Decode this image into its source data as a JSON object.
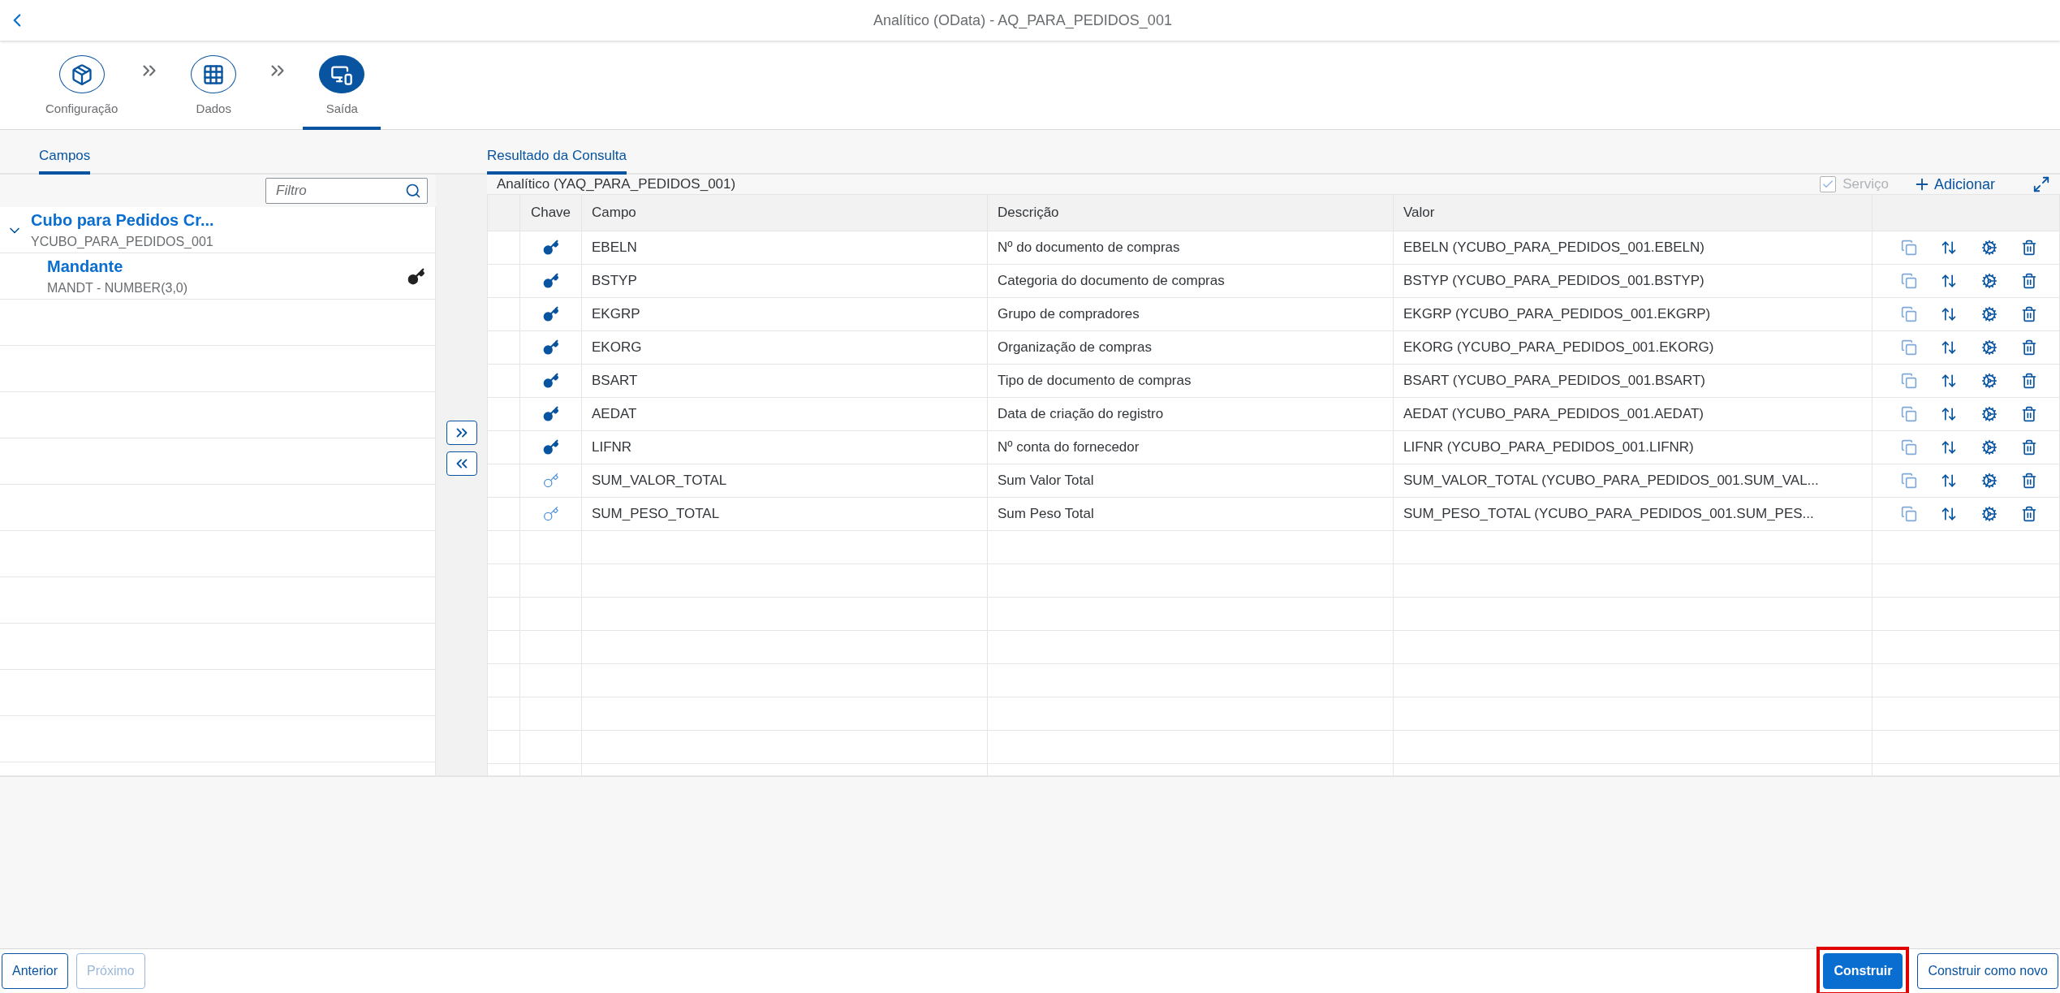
{
  "header": {
    "title": "Analítico (OData) - AQ_PARA_PEDIDOS_001"
  },
  "steps": [
    {
      "label": "Configuração",
      "kind": "config",
      "selected": false
    },
    {
      "label": "Dados",
      "kind": "data",
      "selected": false
    },
    {
      "label": "Saída",
      "kind": "output",
      "selected": true
    }
  ],
  "left_pane": {
    "tab": {
      "label": "Campos",
      "selected": true
    },
    "filter": {
      "placeholder": "Filtro"
    },
    "tree": [
      {
        "title": "Cubo para Pedidos Cr...",
        "subtitle": "YCUBO_PARA_PEDIDOS_001",
        "expanded": true,
        "children": [
          {
            "title": "Mandante",
            "subtitle": "MANDT - NUMBER(3,0)",
            "key": true
          }
        ]
      }
    ]
  },
  "right_pane": {
    "tab": {
      "label": "Resultado da Consulta",
      "selected": true
    },
    "title": "Analítico (YAQ_PARA_PEDIDOS_001)",
    "service": {
      "label": "Serviço",
      "checked": true,
      "disabled": true
    },
    "add_button": "Adicionar",
    "table": {
      "columns": [
        "Chave",
        "Campo",
        "Descrição",
        "Valor"
      ],
      "rows": [
        {
          "key": true,
          "field": "EBELN",
          "description": "Nº do documento de compras",
          "value": "EBELN (YCUBO_PARA_PEDIDOS_001.EBELN)"
        },
        {
          "key": true,
          "field": "BSTYP",
          "description": "Categoria do documento de compras",
          "value": "BSTYP (YCUBO_PARA_PEDIDOS_001.BSTYP)"
        },
        {
          "key": true,
          "field": "EKGRP",
          "description": "Grupo de compradores",
          "value": "EKGRP (YCUBO_PARA_PEDIDOS_001.EKGRP)"
        },
        {
          "key": true,
          "field": "EKORG",
          "description": "Organização de compras",
          "value": "EKORG (YCUBO_PARA_PEDIDOS_001.EKORG)"
        },
        {
          "key": true,
          "field": "BSART",
          "description": "Tipo de documento de compras",
          "value": "BSART (YCUBO_PARA_PEDIDOS_001.BSART)"
        },
        {
          "key": true,
          "field": "AEDAT",
          "description": "Data de criação do registro",
          "value": "AEDAT (YCUBO_PARA_PEDIDOS_001.AEDAT)"
        },
        {
          "key": true,
          "field": "LIFNR",
          "description": "Nº conta do fornecedor",
          "value": "LIFNR (YCUBO_PARA_PEDIDOS_001.LIFNR)"
        },
        {
          "key": false,
          "field": "SUM_VALOR_TOTAL",
          "description": "Sum Valor Total",
          "value": "SUM_VALOR_TOTAL (YCUBO_PARA_PEDIDOS_001.SUM_VAL..."
        },
        {
          "key": false,
          "field": "SUM_PESO_TOTAL",
          "description": "Sum Peso Total",
          "value": "SUM_PESO_TOTAL (YCUBO_PARA_PEDIDOS_001.SUM_PES..."
        }
      ]
    }
  },
  "footer": {
    "buttons": [
      {
        "label": "Anterior",
        "kind": "ghost",
        "disabled": false,
        "highlighted": false
      },
      {
        "label": "Próximo",
        "kind": "ghost",
        "disabled": true,
        "highlighted": false
      },
      {
        "label": "Construir",
        "kind": "emphasized",
        "disabled": false,
        "highlighted": true
      },
      {
        "label": "Construir como novo",
        "kind": "ghost",
        "disabled": false,
        "highlighted": false
      }
    ]
  }
}
